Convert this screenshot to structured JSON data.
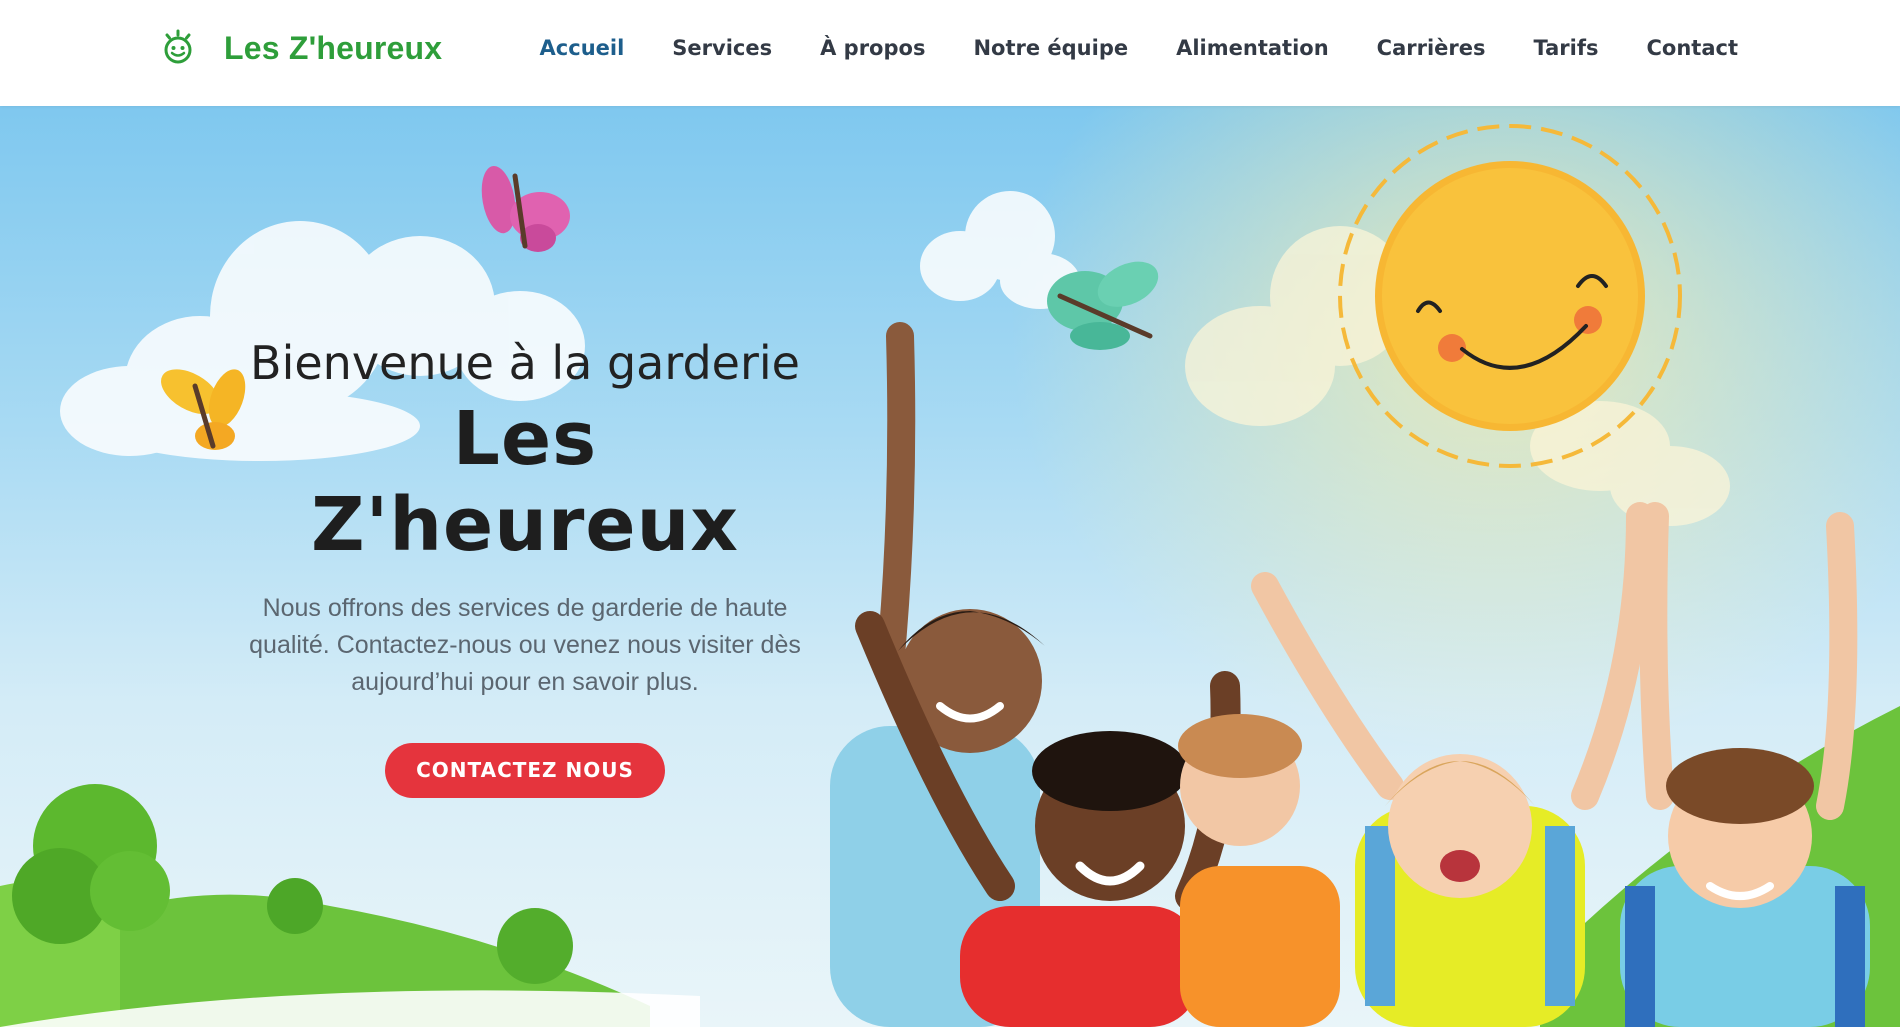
{
  "brand": {
    "name": "Les Z'heureux",
    "logo_icon": "smiley-sun-icon",
    "color": "#2e9e3a"
  },
  "nav": {
    "items": [
      {
        "label": "Accueil",
        "active": true
      },
      {
        "label": "Services"
      },
      {
        "label": "À propos"
      },
      {
        "label": "Notre équipe"
      },
      {
        "label": "Alimentation"
      },
      {
        "label": "Carrières"
      },
      {
        "label": "Tarifs"
      },
      {
        "label": "Contact"
      }
    ],
    "active_color": "#1d5e8c"
  },
  "hero": {
    "title_line1": "Bienvenue à la garderie",
    "title_line2": "Les Z'heureux",
    "description": "Nous offrons des services de garderie de haute qualité. Contactez-nous ou venez nous visiter dès aujourd’hui pour en savoir plus.",
    "cta_label": "CONTACTEZ NOUS",
    "cta_color": "#e5343d",
    "illustration": "happy-children-with-backpacks-raising-arms-under-smiling-sun"
  }
}
